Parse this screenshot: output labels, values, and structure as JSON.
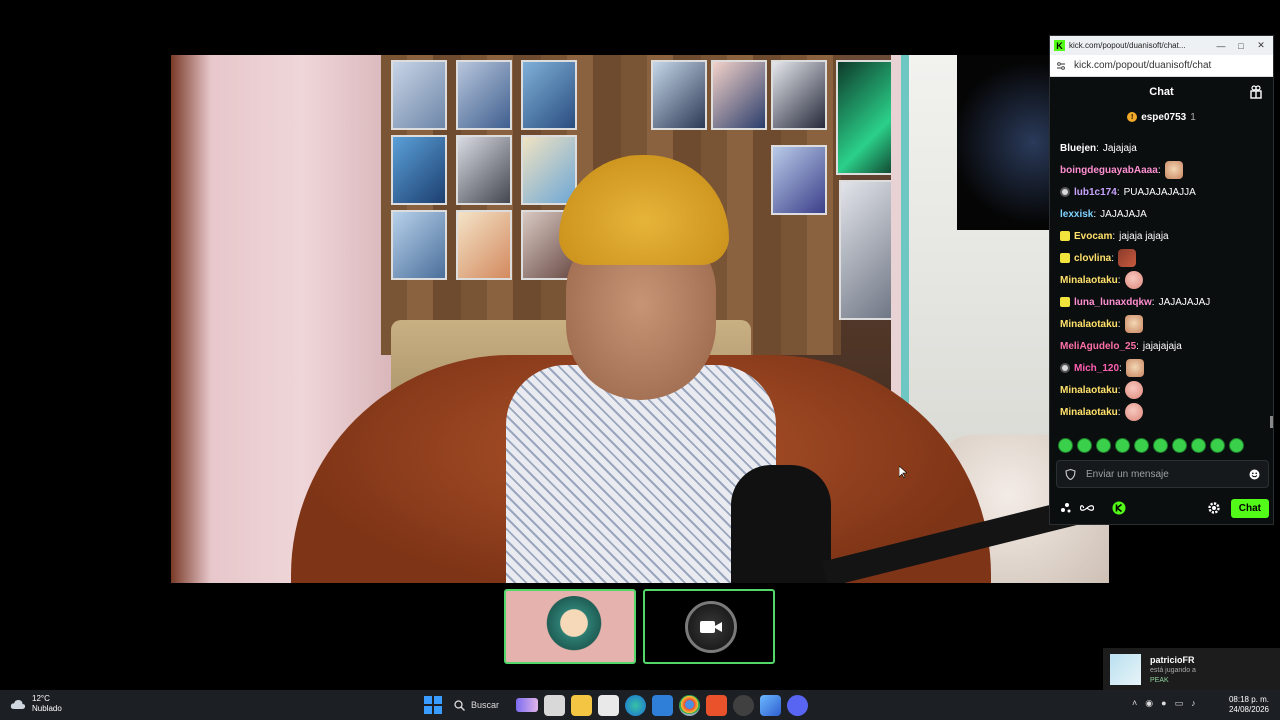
{
  "popout": {
    "title": "kick.com/popout/duanisoft/chat...",
    "url": "kick.com/popout/duanisoft/chat",
    "header": "Chat",
    "pinned_user": "espe0753",
    "pinned_count": "1",
    "messages": [
      {
        "user": "Bluejen",
        "color": "#ffffff",
        "badge": "",
        "text": "Jajajaja",
        "emote": ""
      },
      {
        "user": "boingdeguayabAaaa",
        "color": "#ff8fd0",
        "badge": "",
        "text": "",
        "emote": "face"
      },
      {
        "user": "lub1c174",
        "color": "#c9a4ff",
        "badge": "ring",
        "text": "PUAJAJAJAJJA",
        "emote": ""
      },
      {
        "user": "lexxisk",
        "color": "#7fd3ff",
        "badge": "",
        "text": "JAJAJAJA",
        "emote": ""
      },
      {
        "user": "Evocam",
        "color": "#ffe16b",
        "badge": "sub",
        "text": "jajaja jajaja",
        "emote": ""
      },
      {
        "user": "clovlina",
        "color": "#ffe16b",
        "badge": "sub",
        "text": "",
        "emote": "dark"
      },
      {
        "user": "Minalaotaku",
        "color": "#ffe16b",
        "badge": "",
        "text": "",
        "emote": "blob"
      },
      {
        "user": "luna_lunaxdqkw",
        "color": "#ff8fd0",
        "badge": "sub",
        "text": "JAJAJAJAJ",
        "emote": ""
      },
      {
        "user": "Minalaotaku",
        "color": "#ffe16b",
        "badge": "",
        "text": "",
        "emote": "face"
      },
      {
        "user": "MeliAgudelo_25",
        "color": "#ff6fa8",
        "badge": "",
        "text": "jajajajaja",
        "emote": ""
      },
      {
        "user": "Mich_120",
        "color": "#ff5fb0",
        "badge": "ring",
        "text": "",
        "emote": "face"
      },
      {
        "user": "Minalaotaku",
        "color": "#ffe16b",
        "badge": "",
        "text": "",
        "emote": "blob"
      },
      {
        "user": "Minalaotaku",
        "color": "#ffe16b",
        "badge": "",
        "text": "",
        "emote": "blob"
      }
    ],
    "input_placeholder": "Enviar un mensaje",
    "chat_button": "Chat",
    "accent": "#53fc18"
  },
  "toast": {
    "name": "patricioFR",
    "status": "está jugando a",
    "game": "PEAK"
  },
  "taskbar": {
    "temp": "12°C",
    "weather": "Nublado",
    "search": "Buscar",
    "time": "08:18 p. m.",
    "date": "24/08/2026"
  }
}
